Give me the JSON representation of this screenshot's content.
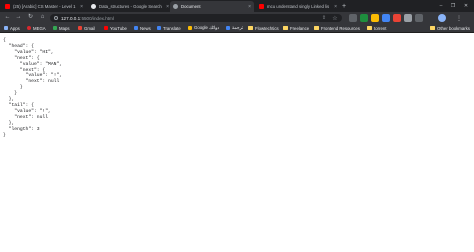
{
  "tabs": [
    {
      "title": "(25) [Arabic] CS Master - Level 1",
      "favicon_color": "#ff0000",
      "active": false
    },
    {
      "title": "Data_structures - Google Search",
      "favicon_color": "#e8eaed",
      "active": false
    },
    {
      "title": "Document",
      "favicon_color": "#9aa0a6",
      "active": true
    },
    {
      "title": "mcu understand singly Linked lis",
      "favicon_color": "#ff0000",
      "active": false
    }
  ],
  "toolbar": {
    "url_host": "127.0.0.1",
    "url_path": ":5500/index.html"
  },
  "bookmarks": [
    {
      "label": "Apps",
      "type": "apps",
      "color": "#8ab4f8"
    },
    {
      "label": "MEGA",
      "type": "site",
      "color": "#d9272e"
    },
    {
      "label": "Maps",
      "type": "site",
      "color": "#34a853"
    },
    {
      "label": "Gmail",
      "type": "site",
      "color": "#ea4335"
    },
    {
      "label": "YouTube",
      "type": "site",
      "color": "#ff0000"
    },
    {
      "label": "News",
      "type": "site",
      "color": "#4285f4"
    },
    {
      "label": "Translate",
      "type": "site",
      "color": "#4285f4"
    },
    {
      "label": "Google دوائك",
      "type": "site",
      "color": "#fbbc04"
    },
    {
      "label": "ترجمة",
      "type": "site",
      "color": "#4285f4"
    },
    {
      "label": "Flowtechtics",
      "type": "folder"
    },
    {
      "label": "Freelance",
      "type": "folder"
    },
    {
      "label": "Frontend Resources",
      "type": "folder"
    },
    {
      "label": "torrent",
      "type": "folder"
    }
  ],
  "other_bookmarks": "Other bookmarks",
  "page": {
    "json_text": "{\n  \"head\": {\n    \"value\": \"HI\",\n    \"next\": {\n      \"value\": \"MAN\",\n      \"next\": {\n        \"value\": \"!\",\n        \"next\": null\n      }\n    }\n  },\n  \"tail\": {\n    \"value\": \"!\",\n    \"next\": null\n  },\n  \"length\": 3\n}"
  }
}
